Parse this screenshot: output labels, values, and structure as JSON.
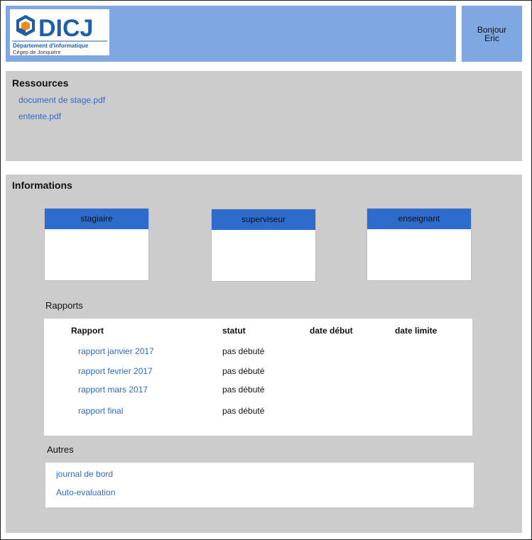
{
  "header": {
    "logo_wordmark": "DICJ",
    "logo_line1": "Département d'informatique",
    "logo_line2": "Cégep de Jonquière",
    "greeting_line1": "Bonjour",
    "greeting_line2": "Eric",
    "colors": {
      "bar": "#7fa8e2",
      "logo_blue": "#1f5fa8",
      "logo_orange": "#f08a1c"
    }
  },
  "resources": {
    "title": "Ressources",
    "links": [
      "document de stage.pdf",
      "entente.pdf"
    ]
  },
  "informations": {
    "title": "Informations",
    "roles": [
      "stagiaire",
      "superviseur",
      "enseignant"
    ],
    "reports_title": "Rapports",
    "reports_table": {
      "columns": [
        "Rapport",
        "statut",
        "date début",
        "date limite"
      ],
      "rows": [
        {
          "name": "rapport janvier 2017",
          "status": "pas débuté",
          "start": "",
          "limit": ""
        },
        {
          "name": "rapport fevrier 2017",
          "status": "pas débuté",
          "start": "",
          "limit": ""
        },
        {
          "name": "rapport mars 2017",
          "status": "pas débuté",
          "start": "",
          "limit": ""
        },
        {
          "name": "rapport final",
          "status": "pas débuté",
          "start": "",
          "limit": ""
        }
      ]
    },
    "others_title": "Autres",
    "others_links": [
      "journal de bord",
      "Auto-evaluation"
    ]
  },
  "colors": {
    "panel_bg": "#cccccc",
    "role_header": "#2d6ccd",
    "link": "#2f69c7"
  }
}
